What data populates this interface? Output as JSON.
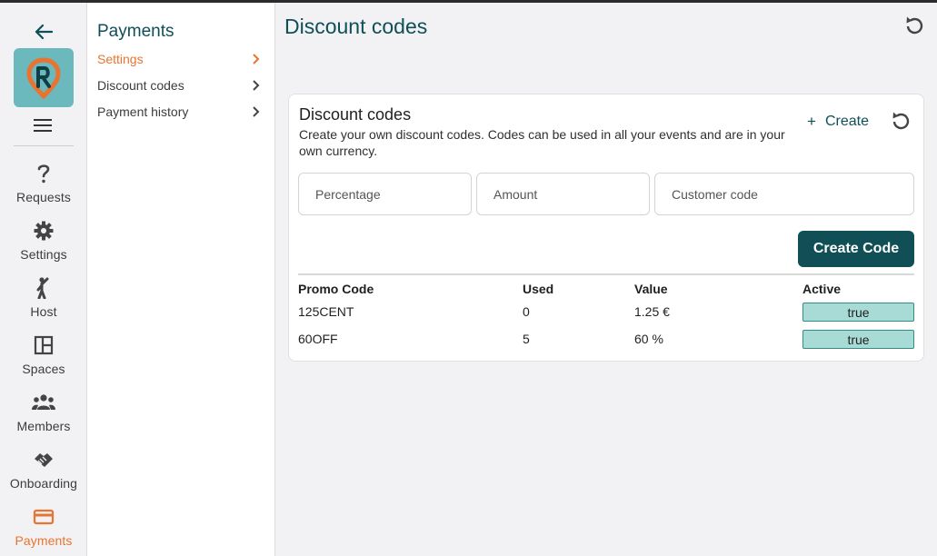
{
  "colors": {
    "accent": "#e8742f",
    "primary": "#0f4f58",
    "badge_bg": "#a9dbd6",
    "logo_bg": "#6bb8bd"
  },
  "rail": {
    "items": [
      {
        "label": "Requests",
        "icon": "question-icon"
      },
      {
        "label": "Settings",
        "icon": "gear-icon"
      },
      {
        "label": "Host",
        "icon": "host-person-icon"
      },
      {
        "label": "Spaces",
        "icon": "layout-icon"
      },
      {
        "label": "Members",
        "icon": "group-icon"
      },
      {
        "label": "Onboarding",
        "icon": "handshake-icon"
      },
      {
        "label": "Payments",
        "icon": "credit-card-icon",
        "active": true
      }
    ]
  },
  "subpanel": {
    "title": "Payments",
    "items": [
      {
        "label": "Settings",
        "active": true
      },
      {
        "label": "Discount codes"
      },
      {
        "label": "Payment history"
      }
    ]
  },
  "main": {
    "title": "Discount codes"
  },
  "card": {
    "title": "Discount codes",
    "description": "Create your own discount codes. Codes can be used in all your events and are in your own currency.",
    "create_label": "Create",
    "fields": {
      "percentage_placeholder": "Percentage",
      "amount_placeholder": "Amount",
      "customer_code_placeholder": "Customer code"
    },
    "create_code_label": "Create Code"
  },
  "table": {
    "columns": [
      "Promo Code",
      "Used",
      "Value",
      "Active"
    ],
    "rows": [
      {
        "code": "125CENT",
        "used": "0",
        "value": "1.25 €",
        "active": "true"
      },
      {
        "code": "60OFF",
        "used": "5",
        "value": "60 %",
        "active": "true"
      }
    ]
  }
}
